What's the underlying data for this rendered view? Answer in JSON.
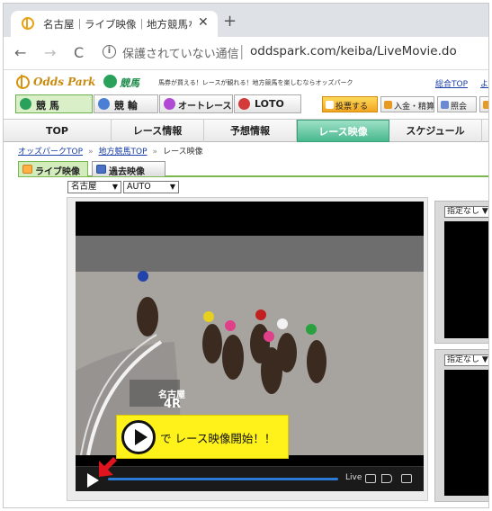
{
  "browser": {
    "tab_title": "名古屋｜ライブ映像｜地方競馬な",
    "tab_close": "✕",
    "new_tab": "+",
    "back": "←",
    "forward": "→",
    "reload": "C",
    "info": "i",
    "security_text": "保護されていない通信",
    "url": "oddspark.com/keiba/LiveMovie.do"
  },
  "site": {
    "logo_text": "Odds Park",
    "keiba_logo_text": "競馬",
    "tagline": "馬券が買える！レースが観れる！地方競馬を楽しむならオッズパーク",
    "top_link": "総合TOP",
    "top_link2": "よく"
  },
  "categories": [
    {
      "label": "競 馬",
      "color": "#2aa15a"
    },
    {
      "label": "競 輪",
      "color": "#4a7fd4"
    },
    {
      "label": "オートレース",
      "color": "#b04ad4"
    },
    {
      "label": "LOTO",
      "color": "#d43a3a"
    }
  ],
  "actions": {
    "vote": "投票する",
    "deposit": "入金・精算",
    "inquiry": "照会"
  },
  "mainnav": [
    "TOP",
    "レース情報",
    "予想情報",
    "レース映像",
    "スケジュール"
  ],
  "breadcrumb": {
    "home": "オッズパークTOP",
    "section": "地方競馬TOP",
    "current": "レース映像",
    "sep": "»"
  },
  "subtabs": {
    "live": "ライブ映像",
    "past": "過去映像"
  },
  "selects": {
    "venue": "名古屋",
    "mode": "AUTO",
    "arrow": "▼"
  },
  "video": {
    "venue_badge": "名古屋",
    "race_badge": "4R",
    "overlay_text": "で レース映像開始！！",
    "live_label": "Live"
  },
  "side": {
    "select1": "指定なし",
    "select2": "指定なし"
  },
  "colors": {
    "accent_green": "#49b98e",
    "overlay_yellow": "#fff21a",
    "seek_blue": "#2b7bd6"
  }
}
